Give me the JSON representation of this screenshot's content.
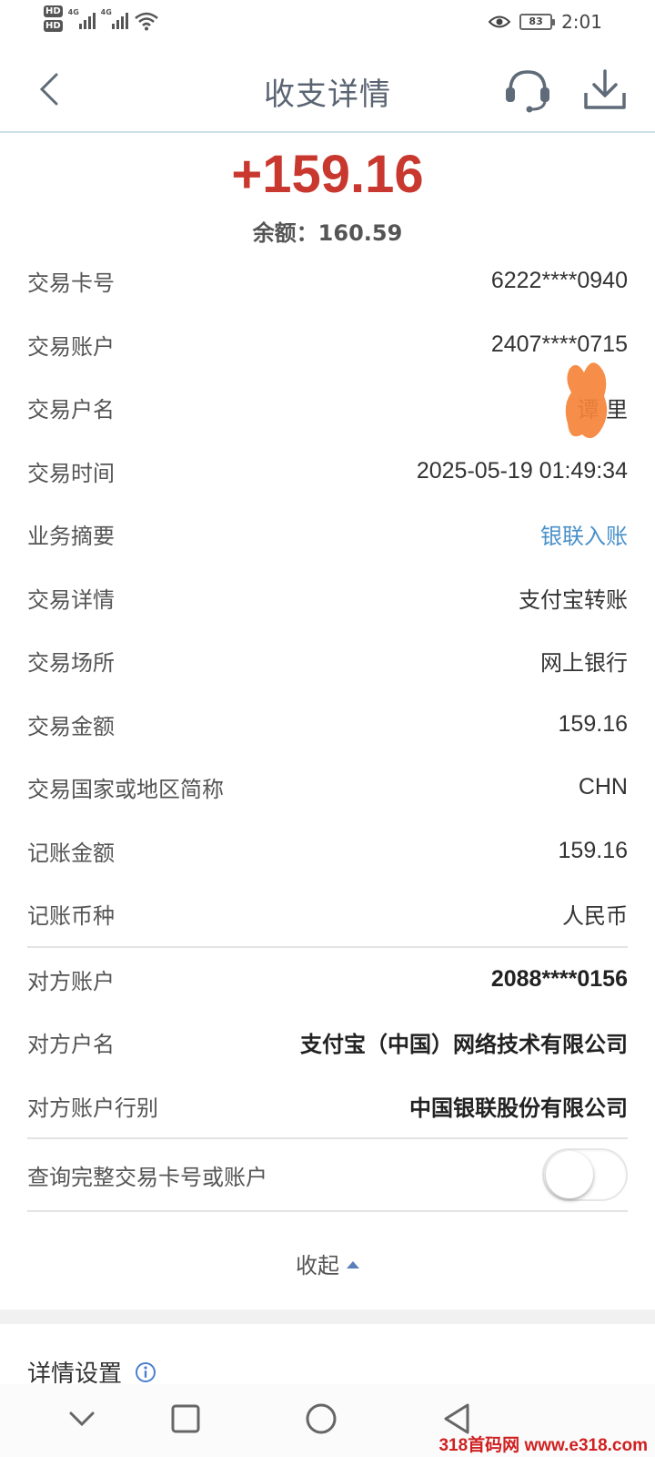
{
  "status_bar": {
    "hd1": "HD",
    "hd2": "HD",
    "net1": "4G",
    "net2": "4G",
    "battery": "83",
    "time": "2:01"
  },
  "header": {
    "title": "收支详情"
  },
  "summary": {
    "amount": "+159.16",
    "balance": "余额：160.59",
    "amount_color": "#c8382f"
  },
  "details": [
    {
      "label": "交易卡号",
      "value": "6222****0940"
    },
    {
      "label": "交易账户",
      "value": "2407****0715"
    },
    {
      "label": "交易户名",
      "value": "谭 里"
    },
    {
      "label": "交易时间",
      "value": "2025-05-19 01:49:34"
    },
    {
      "label": "业务摘要",
      "value": "银联入账"
    },
    {
      "label": "交易详情",
      "value": "支付宝转账"
    },
    {
      "label": "交易场所",
      "value": "网上银行"
    },
    {
      "label": "交易金额",
      "value": "159.16"
    },
    {
      "label": "交易国家或地区简称",
      "value": "CHN"
    },
    {
      "label": "记账金额",
      "value": "159.16"
    },
    {
      "label": "记账币种",
      "value": "人民币"
    }
  ],
  "counterparty": [
    {
      "label": "对方账户",
      "value": "2088****0156"
    },
    {
      "label": "对方户名",
      "value": "支付宝（中国）网络技术有限公司"
    },
    {
      "label": "对方账户行别",
      "value": "中国银联股份有限公司"
    }
  ],
  "toggle": {
    "label": "查询完整交易卡号或账户",
    "on": false
  },
  "collapse_label": "收起",
  "settings": {
    "title": "详情设置"
  },
  "watermark": "318首码网 www.e318.com",
  "colors": {
    "link": "#4a90c9",
    "redaction": "#f5833a"
  }
}
